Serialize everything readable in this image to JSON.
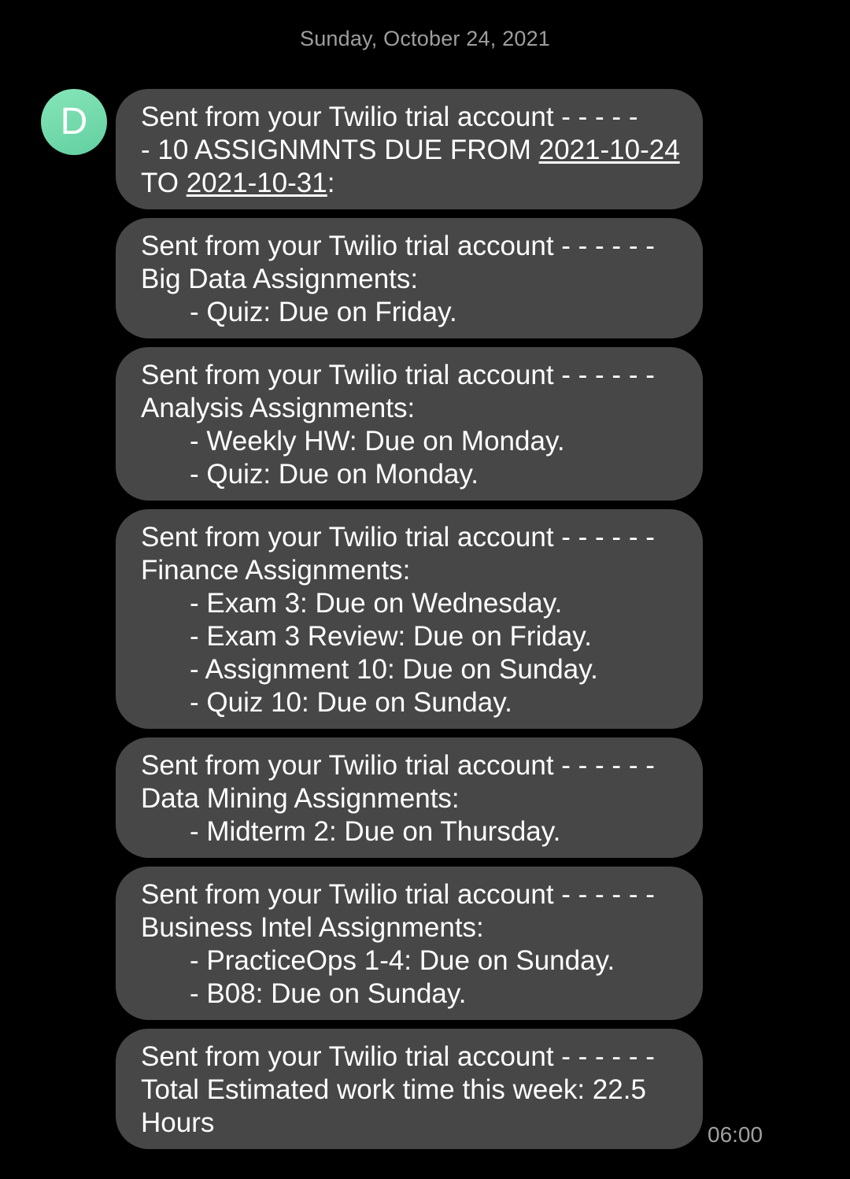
{
  "conversation": {
    "date_header": "Sunday, October 24, 2021",
    "avatar_letter": "D",
    "timestamp": "06:00",
    "accent_color": "#72d9ac",
    "bubble_color": "#474747"
  },
  "messages": [
    {
      "prefix": "Sent from your Twilio trial account - - - - -",
      "line2_a": "- 10 ASSIGNMNTS DUE FROM ",
      "date_from": "2021-10-24",
      "line3_a": "TO ",
      "date_to": "2021-10-31",
      "line3_b": ":"
    },
    {
      "prefix": "Sent from your Twilio trial account - - - - - -",
      "heading": "Big Data Assignments:",
      "items": [
        "- Quiz: Due on Friday."
      ]
    },
    {
      "prefix": "Sent from your Twilio trial account - - - - - -",
      "heading": "Analysis Assignments:",
      "items": [
        "- Weekly HW: Due on Monday.",
        "- Quiz: Due on Monday."
      ]
    },
    {
      "prefix": "Sent from your Twilio trial account - - - - - -",
      "heading": "Finance Assignments:",
      "items": [
        "- Exam 3: Due on Wednesday.",
        "- Exam 3 Review: Due on Friday.",
        "- Assignment 10: Due on Sunday.",
        "- Quiz 10: Due on Sunday."
      ]
    },
    {
      "prefix": "Sent from your Twilio trial account - - - - - -",
      "heading": "Data Mining Assignments:",
      "items": [
        "- Midterm 2: Due on Thursday."
      ]
    },
    {
      "prefix": "Sent from your Twilio trial account - - - - - -",
      "heading": "Business Intel Assignments:",
      "items": [
        "- PracticeOps 1-4: Due on Sunday.",
        "- B08: Due on Sunday."
      ]
    },
    {
      "prefix": "Sent from your Twilio trial account - - - - - -",
      "body_line1": "Total Estimated work time this week: 22.5",
      "body_line2": "Hours"
    }
  ]
}
